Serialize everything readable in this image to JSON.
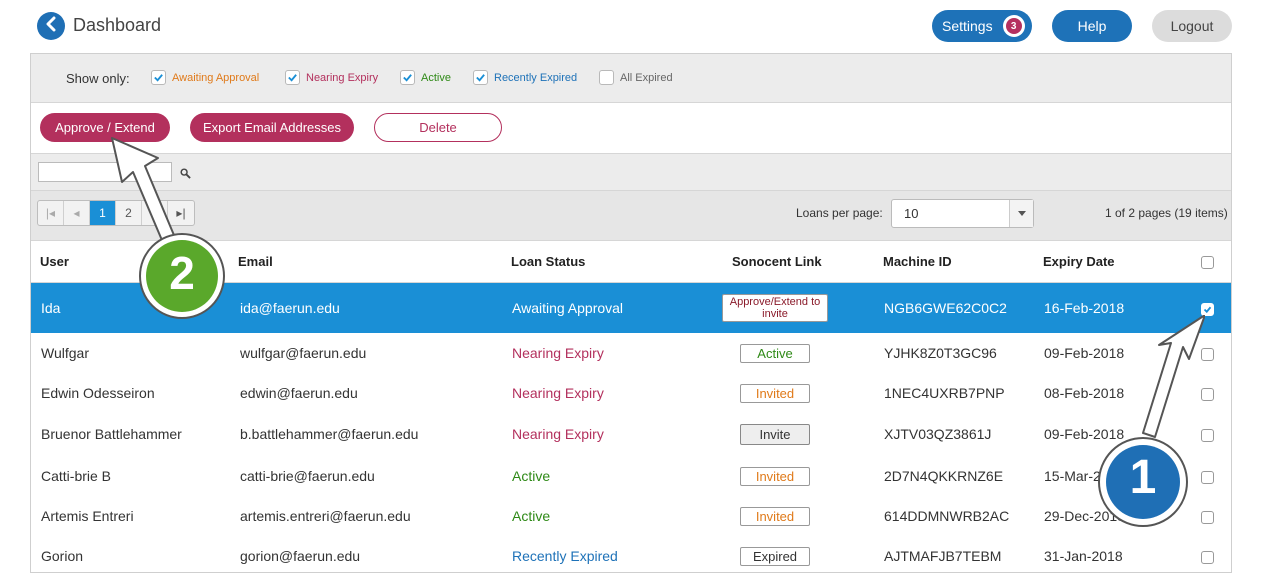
{
  "header": {
    "title": "Dashboard",
    "settings_label": "Settings",
    "settings_badge": "3",
    "help_label": "Help",
    "logout_label": "Logout"
  },
  "filters": {
    "show_only_label": "Show only:",
    "items": [
      {
        "label": "Awaiting Approval",
        "checked": true,
        "color": "#e07a1a"
      },
      {
        "label": "Nearing Expiry",
        "checked": true,
        "color": "#b3305d"
      },
      {
        "label": "Active",
        "checked": true,
        "color": "#2f8a17"
      },
      {
        "label": "Recently Expired",
        "checked": true,
        "color": "#1e72b8"
      },
      {
        "label": "All Expired",
        "checked": false,
        "color": "#666666"
      }
    ]
  },
  "actions": {
    "approve_label": "Approve / Extend",
    "export_label": "Export Email Addresses",
    "delete_label": "Delete"
  },
  "search": {
    "value": ""
  },
  "pager": {
    "pages": [
      "1",
      "2"
    ],
    "current_page": "1",
    "loans_per_page_label": "Loans per page:",
    "loans_per_page_value": "10",
    "page_info": "1 of 2 pages (19 items)"
  },
  "table": {
    "columns": [
      "User",
      "Email",
      "Loan Status",
      "Sonocent Link",
      "Machine ID",
      "Expiry Date"
    ],
    "rows": [
      {
        "user": "Ida",
        "email": "ida@faerun.edu",
        "status": "Awaiting Approval",
        "link": "Approve/Extend to invite",
        "machine": "NGB6GWE62C0C2",
        "expiry": "16-Feb-2018",
        "checked": true,
        "selected": true
      },
      {
        "user": "Wulfgar",
        "email": "wulfgar@faerun.edu",
        "status": "Nearing Expiry",
        "link": "Active",
        "machine": "YJHK8Z0T3GC96",
        "expiry": "09-Feb-2018",
        "checked": false
      },
      {
        "user": "Edwin Odesseiron",
        "email": "edwin@faerun.edu",
        "status": "Nearing Expiry",
        "link": "Invited",
        "machine": "1NEC4UXRB7PNP",
        "expiry": "08-Feb-2018",
        "checked": false
      },
      {
        "user": "Bruenor Battlehammer",
        "email": "b.battlehammer@faerun.edu",
        "status": "Nearing Expiry",
        "link": "Invite",
        "machine": "XJTV03QZ3861J",
        "expiry": "09-Feb-2018",
        "checked": false
      },
      {
        "user": "Catti-brie B",
        "email": "catti-brie@faerun.edu",
        "status": "Active",
        "link": "Invited",
        "machine": "2D7N4QKKRNZ6E",
        "expiry": "15-Mar-2",
        "checked": false
      },
      {
        "user": "Artemis Entreri",
        "email": "artemis.entreri@faerun.edu",
        "status": "Active",
        "link": "Invited",
        "machine": "614DDMNWRB2AC",
        "expiry": "29-Dec-2018",
        "checked": false
      },
      {
        "user": "Gorion",
        "email": "gorion@faerun.edu",
        "status": "Recently Expired",
        "link": "Expired",
        "machine": "AJTMAFJB7TEBM",
        "expiry": "31-Jan-2018",
        "checked": false
      }
    ]
  },
  "callouts": {
    "one": "1",
    "two": "2"
  },
  "colors": {
    "accent": "#1a8fd6",
    "brand": "#b3305d",
    "callout_green": "#5aa82b",
    "callout_blue": "#1f6fb5"
  }
}
